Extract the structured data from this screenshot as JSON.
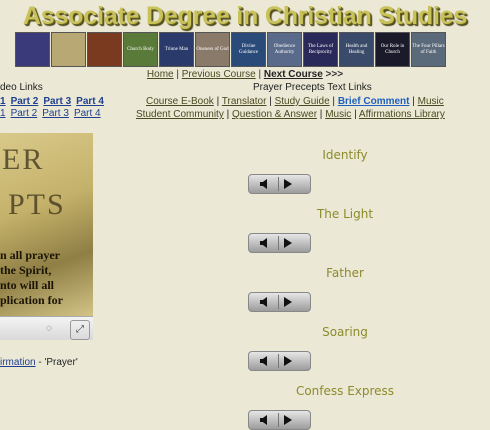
{
  "header": {
    "title": "Associate Degree in Christian Studies"
  },
  "thumbnails": [
    {
      "label": "",
      "color": "#3a3a7a"
    },
    {
      "label": "",
      "color": "#b8a873"
    },
    {
      "label": "",
      "color": "#7a3a20"
    },
    {
      "label": "Church Body",
      "color": "#5a7a3a"
    },
    {
      "label": "Triune Man",
      "color": "#2a3a6a"
    },
    {
      "label": "Oneness of God",
      "color": "#8a7a6a"
    },
    {
      "label": "Divine Guidance",
      "color": "#2a4a7a"
    },
    {
      "label": "Obedience Authority",
      "color": "#5a6a8a"
    },
    {
      "label": "The Laws of Reciprocity",
      "color": "#2a2a5a"
    },
    {
      "label": "Health and Healing",
      "color": "#3a4a6a"
    },
    {
      "label": "Our Role in Church",
      "color": "#1a1a2a"
    },
    {
      "label": "The Four Pillars of Faith",
      "color": "#5a6a7a"
    }
  ],
  "nav": {
    "home": "Home",
    "sep1": " | ",
    "previous": "Previous Course",
    "sep2": " | ",
    "next": "Next Course",
    "arrows": " >>>"
  },
  "video_links": {
    "heading": "deo Links",
    "row1": [
      "1",
      "Part 2",
      "Part 3",
      "Part 4"
    ],
    "row2": [
      "1",
      "Part 2",
      "Part 3",
      "Part 4"
    ]
  },
  "text_links": {
    "heading": "Prayer Precepts Text Links",
    "row1": [
      {
        "label": "Course E-Book",
        "style": "lnk"
      },
      {
        "label": "Translator",
        "style": "lnk"
      },
      {
        "label": "Study Guide",
        "style": "lnk"
      },
      {
        "label": "Brief Comment",
        "style": "blue"
      },
      {
        "label": "Music",
        "style": "lnk"
      }
    ],
    "row2": [
      {
        "label": "Student Community",
        "style": "lnk"
      },
      {
        "label": "Question & Answer",
        "style": "lnk"
      },
      {
        "label": "Music",
        "style": "lnk"
      },
      {
        "label": "Affirmations Library",
        "style": "lnk"
      }
    ]
  },
  "video": {
    "big1": "ER",
    "big2": "PTS",
    "lines": [
      "n all prayer",
      "the Spirit,",
      "nto will all",
      "plication for"
    ]
  },
  "caption": {
    "link": "irmation",
    "rest": " - 'Prayer'"
  },
  "prayers": [
    {
      "title": "Identify"
    },
    {
      "title": "The Light"
    },
    {
      "title": "Father"
    },
    {
      "title": "Soaring"
    },
    {
      "title": "Confess Express"
    }
  ]
}
